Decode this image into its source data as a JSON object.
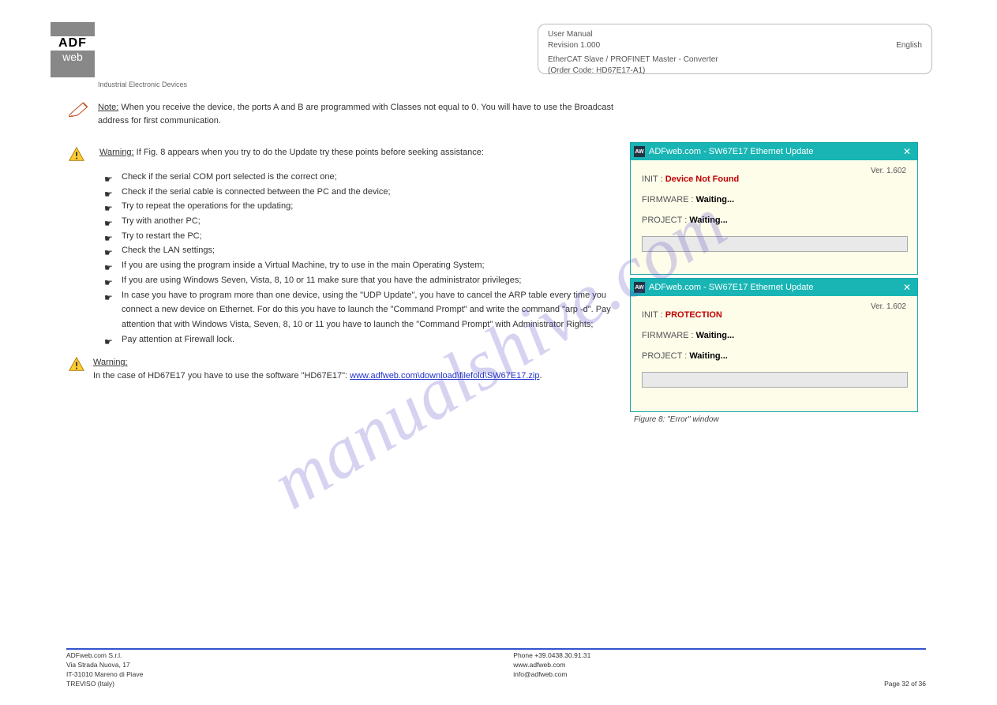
{
  "logo": {
    "top": "ADF",
    "bottom": "web"
  },
  "industrial_label": "Industrial Electronic Devices",
  "header": {
    "line1": "User Manual",
    "line2_left": "Revision 1.000",
    "line2_right": "English",
    "title": "EtherCAT Slave / PROFINET Master - Converter",
    "subtitle": "(Order Code: HD67E17-A1)"
  },
  "note": {
    "label": "Note:",
    "text": " When you receive the device, the ports A and B are programmed with Classes not equal to 0. You will have to use the Broadcast address for first communication."
  },
  "warning": {
    "label": "Warning:",
    "intro": " If Fig. 8 appears when you try to do the Update try these points before seeking assistance:",
    "items": [
      "Check if the serial COM port selected is the correct one;",
      "Check if the serial cable is connected between the PC and the device;",
      "Try to repeat the operations for the updating;",
      "Try with another PC;",
      "Try to restart the PC;",
      "Check the LAN settings;",
      "If you are using the program inside a Virtual Machine, try to use in the main Operating System;",
      "If you are using Windows Seven, Vista, 8, 10 or 11 make sure that you have the administrator privileges;",
      "In case you have to program more than one device, using the \"UDP Update\", you have to cancel the ARP table every time you connect a new device on Ethernet. For do this you have to launch the \"Command Prompt\" and write the command \"arp -d\". Pay attention that with Windows Vista, Seven, 8, 10 or 11 you have to launch the \"Command Prompt\" with Administrator Rights;",
      "Pay attention at Firewall lock."
    ]
  },
  "warning2": {
    "label": "Warning:",
    "text_before": "In the case of HD67E17 you have to use the software \"HD67E17\": ",
    "link": "www.adfweb.com\\download\\filefold\\SW67E17.zip",
    "text_after": "."
  },
  "figure_caption": "Figure 8: \"Error\" window",
  "dialog1": {
    "title": "ADFweb.com - SW67E17 Ethernet Update",
    "version": "Ver. 1.602",
    "init_label": "INIT :",
    "init_value": "Device Not Found",
    "fw_label": "FIRMWARE :",
    "fw_value": "Waiting...",
    "proj_label": "PROJECT :",
    "proj_value": "Waiting..."
  },
  "dialog2": {
    "title": "ADFweb.com - SW67E17 Ethernet Update",
    "version": "Ver. 1.602",
    "init_label": "INIT :",
    "init_value": "PROTECTION",
    "fw_label": "FIRMWARE :",
    "fw_value": "Waiting...",
    "proj_label": "PROJECT :",
    "proj_value": "Waiting..."
  },
  "footer": {
    "left_line1": "ADFweb.com S.r.l.",
    "left_line2": "Via Strada Nuova, 17",
    "left_line3": "IT-31010 Mareno di Piave",
    "left_line4": "TREVISO (Italy)",
    "right_line1": "Phone +39.0438.30.91.31",
    "right_line2": "www.adfweb.com",
    "right_line3": "info@adfweb.com",
    "page_info": "Page 32 of 36"
  },
  "watermark": "manualshive.com"
}
